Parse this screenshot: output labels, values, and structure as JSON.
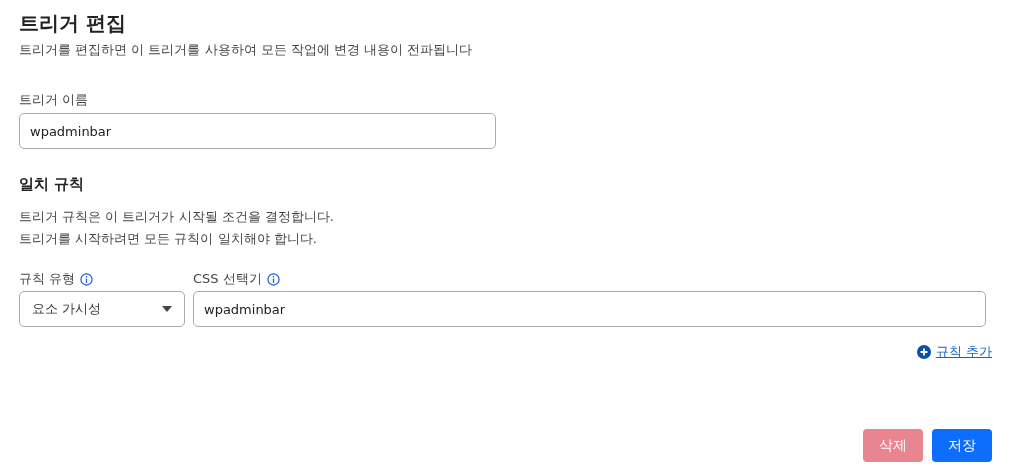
{
  "header": {
    "title": "트리거 편집",
    "subtitle": "트리거를 편집하면 이 트리거를 사용하여 모든 작업에 변경 내용이 전파됩니다"
  },
  "name_field": {
    "label": "트리거 이름",
    "value": "wpadminbar"
  },
  "rules": {
    "title": "일치 규칙",
    "description": [
      "트리거 규칙은 이 트리거가 시작될 조건을 결정합니다.",
      "트리거를 시작하려면 모든 규칙이 일치해야 합니다."
    ],
    "type_label": "규칙 유형",
    "selector_label": "CSS 선택기",
    "items": [
      {
        "type": "요소 가시성",
        "selector": "wpadminbar"
      }
    ],
    "add_link": "규칙 추가"
  },
  "buttons": [
    {
      "label": "삭제",
      "kind": "danger",
      "disabled": true
    },
    {
      "label": "저장",
      "kind": "primary",
      "disabled": false
    }
  ]
}
